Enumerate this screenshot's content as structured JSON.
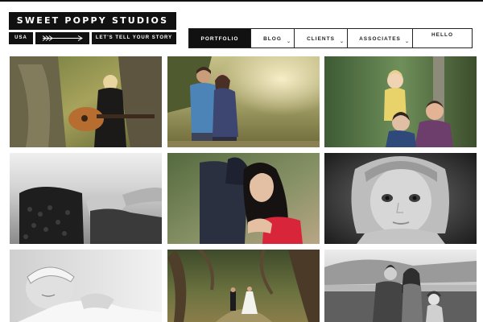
{
  "logo": {
    "title": "SWEET POPPY STUDIOS",
    "country": "USA",
    "tagline": "LET'S TELL YOUR STORY",
    "arrow_icon": "double-arrow-icon"
  },
  "nav": {
    "items": [
      {
        "label": "PORTFOLIO",
        "active": true
      },
      {
        "label": "BLOG",
        "active": false
      },
      {
        "label": "CLIENTS",
        "active": false
      },
      {
        "label": "ASSOCIATES",
        "active": false
      },
      {
        "label": "HELLO",
        "active": false
      }
    ]
  },
  "gallery": {
    "photos": [
      {
        "name": "photo-woman-guitar-tree",
        "desc_icon": "photo-icon"
      },
      {
        "name": "photo-couple-field",
        "desc_icon": "photo-icon"
      },
      {
        "name": "photo-family-child",
        "desc_icon": "photo-icon"
      },
      {
        "name": "photo-hands-lace-bw",
        "desc_icon": "photo-icon"
      },
      {
        "name": "photo-couple-embrace",
        "desc_icon": "photo-icon"
      },
      {
        "name": "photo-girl-portrait-bw",
        "desc_icon": "photo-icon"
      },
      {
        "name": "photo-newborn-bw",
        "desc_icon": "photo-icon"
      },
      {
        "name": "photo-wedding-forest",
        "desc_icon": "photo-icon"
      },
      {
        "name": "photo-family-bay",
        "desc_icon": "photo-icon"
      }
    ]
  }
}
